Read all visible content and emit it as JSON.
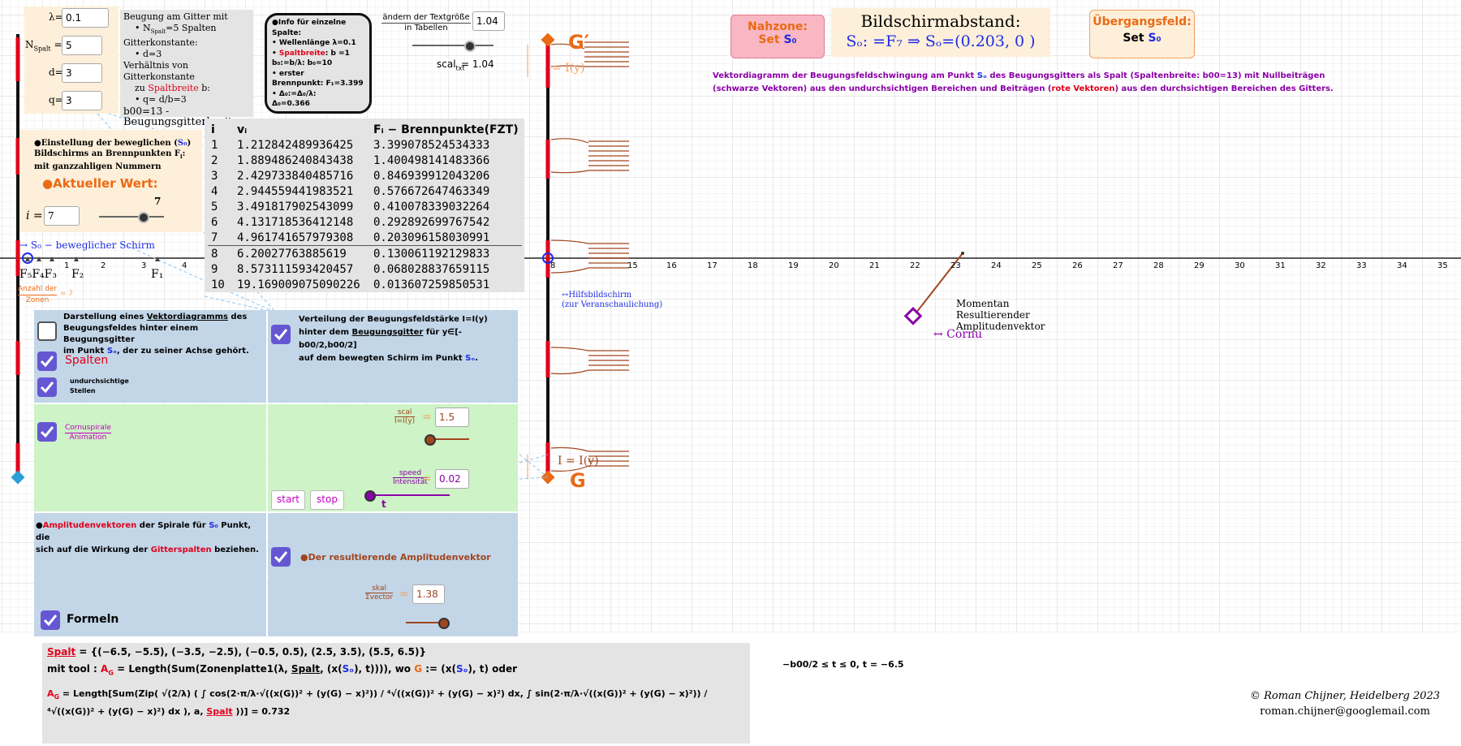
{
  "params": {
    "lambda_label": "λ=",
    "lambda_value": "0.1",
    "n_label": "N",
    "n_sub": "Spalt",
    "n_eq": " =",
    "n_value": "5",
    "d_label": "d=",
    "d_value": "3",
    "q_label": "q=",
    "q_value": "3"
  },
  "gitter_info": {
    "line1": "Beugung am Gitter mit",
    "line2": "• N",
    "line2_sub": "Spalt",
    "line2_rest": "=5 Spalten",
    "line3": "Gitterkonstante:",
    "line4": "• d=3",
    "line5": "Verhältnis von Gitterkonstante",
    "line6_a": "zu ",
    "line6_b": "Spaltbreite",
    "line6_c": " b:",
    "line7": "• q= d/b=3",
    "line8": "b00=13   -",
    "line9": "Beugungsgitterbreite"
  },
  "spalt_info": {
    "title": "●Info für einzelne Spalte:",
    "l1": "• Wellenlänge λ=0.1",
    "l2_a": "• ",
    "l2_b": "Spaltbreite",
    "l2_c": ": b =1",
    "l3": "b₀:=b/λ:     b₀=10",
    "l4": "• erster",
    "l5": "Brennpunkt:  F₁=3.399",
    "l6": "• Δ₀:=Δ₀/λ:",
    "l7": "Δ₀=0.366"
  },
  "textsize": {
    "label_top": "ändern der Textgröße",
    "label_bottom": "in Tabellen",
    "value": "1.04",
    "scal_label": "scal",
    "scal_sub": "txt",
    "scal_value": "= 1.04"
  },
  "nahzone": {
    "title": "Nahzone:",
    "set": "Set ",
    "s0": "S₀"
  },
  "bildschirm": {
    "title": "Bildschirmabstand:",
    "formula": "Sₒ: =F₇  ⇒  Sₒ=(0.203, 0 )"
  },
  "uebergang": {
    "title": "Übergangsfeld:",
    "set": "Set ",
    "s0": "S₀"
  },
  "vektor_desc": {
    "p1": "Vektordiagramm der Beugungsfeldschwingung am Punkt ",
    "s0": "Sₒ",
    "p2": " des Beugungsgitters als Spalt (Spaltenbreite: b00=13) mit Nullbeiträgen",
    "p3": "(schwarze Vektoren) aus den undurchsichtigen Bereichen und Beiträgen (",
    "p4": "rote Vektoren",
    "p5": ") aus den durchsichtigen Bereichen des Gitters."
  },
  "einstellung": {
    "l1_a": "●Einstellung der beweglichen (",
    "l1_b": "S₀",
    "l1_c": ")",
    "l2": "Bildschirms an Brennpunkten F",
    "l2_sub": "i",
    "l2_rest": ":",
    "l3": "mit ganzzahligen Nummern",
    "aktuell": "●Aktueller  Wert:",
    "i_label": "i =",
    "i_value": "7",
    "slider_value": "7"
  },
  "table": {
    "headers": [
      "i",
      "vᵢ",
      "Fᵢ − Brennpunkte(FZT)"
    ],
    "rows": [
      [
        "1",
        "1.212842489936425",
        "3.399078524534333"
      ],
      [
        "2",
        "1.889486240843438",
        "1.400498141483366"
      ],
      [
        "3",
        "2.429733840485716",
        "0.846939912043206"
      ],
      [
        "4",
        "2.944559441983521",
        "0.576672647463349"
      ],
      [
        "5",
        "3.491817902543099",
        "0.410078339032264"
      ],
      [
        "6",
        "4.131718536412148",
        "0.292892699767542"
      ],
      [
        "7",
        "4.961741657979308",
        "0.203096158030991"
      ],
      [
        "8",
        "6.20027763885619",
        "0.130061192129833"
      ],
      [
        "9",
        "8.573111593420457",
        "0.068028837659115"
      ],
      [
        "10",
        "19.169009075090226",
        "0.013607259850531"
      ]
    ]
  },
  "axis": {
    "s0_label": "→ S₀ − beweglicher Schirm",
    "f_labels": [
      "F₅",
      "F₄",
      "F₃",
      "F₂",
      "F₁"
    ],
    "anzahl_label_1": "Anzahl der",
    "anzahl_label_2": "Zonen",
    "anzahl_value": "= 7",
    "ticks": [
      "1",
      "2",
      "3",
      "4",
      "8",
      "15",
      "16",
      "17",
      "18",
      "19",
      "20",
      "21",
      "22",
      "23",
      "24",
      "25",
      "26",
      "27",
      "28",
      "29",
      "30",
      "31",
      "32",
      "33",
      "34",
      "35"
    ],
    "g_prime": "G′",
    "i_top": "= I(y)",
    "i_bottom": "I = I(y)",
    "g_label": "G",
    "hilfs_1": "↔Hilfsbildschirm",
    "hilfs_2": "(zur Veranschaulichung)",
    "momentan_1": "Momentan",
    "momentan_2": "Resultierender",
    "momentan_3": "Amplitudenvektor",
    "cornu": "↔ Cornu"
  },
  "left_panel": {
    "desc_1": "Darstellung eines ",
    "desc_vd": "Vektordiagramms",
    "desc_2": " des",
    "desc_3": "Beugungsfeldes hinter einem Beugungsgitter",
    "desc_4a": "im Punkt ",
    "desc_4b": "Sₒ",
    "desc_4c": ", der zu seiner Achse gehört.",
    "spalten": "Spalten",
    "undurch_1": "undurchsichtige",
    "undurch_2": "Stellen",
    "cornu_1": "Cornuspirale",
    "cornu_2": "Animation",
    "ampl_a": "●",
    "ampl_b": "Amplitudenvektoren",
    "ampl_c": " der Spirale für ",
    "ampl_d": "S₀",
    "ampl_e": " Punkt, die",
    "ampl_f": "sich auf die Wirkung der ",
    "ampl_g": "Gitterspalten",
    "ampl_h": " beziehen.",
    "formeln": "Formeln"
  },
  "right_panel": {
    "vert_1": "Verteilung der Beugungsfeldstärke I=I(y)",
    "vert_2a": "hinter dem ",
    "vert_2b": "Beugungsgitter",
    "vert_2c": " für y∈[-b00/2,b00/2]",
    "vert_3a": "auf dem bewegten Schirm im Punkt ",
    "vert_3b": "Sₒ",
    "vert_3c": ".",
    "scal_top": "scal",
    "scal_bottom": "I=I(y)",
    "scal_value": "1.5",
    "speed_top": "speed",
    "speed_bottom": "Intensität",
    "speed_value": "0.02",
    "start": "start",
    "stop": "stop",
    "t_label": "t",
    "result": "●Der resultierende Amplitudenvektor",
    "skal_top": "skal",
    "skal_bottom": "Σvector",
    "skal_value": "1.38"
  },
  "formula": {
    "l1_a": "Spalt",
    "l1_b": " = {(−6.5, −5.5), (−3.5, −2.5), (−0.5, 0.5), (2.5, 3.5), (5.5, 6.5)}",
    "l2_a": "mit tool : ",
    "l2_b": "A",
    "l2_c": " = Length(Sum(Zonenplatte1(λ, ",
    "l2_d": "Spalt",
    "l2_e": ", (x(",
    "l2_f": "Sₒ",
    "l2_g": "), t)))),  wo ",
    "l2_h": "G",
    "l2_i": " := (x(",
    "l2_j": "Sₒ",
    "l2_k": "), t) oder",
    "l3_a": "A",
    "l3_b": " = Length[Sum(Zip( √(2/λ) ( ∫ cos(2·π/λ·√((x(G))² + (y(G) − x)²)) / ⁴√((x(G))² + (y(G) − x)²) dx,  ∫ sin(2·π/λ·√((x(G))² + (y(G) − x)²)) / ⁴√((x(G))² + (y(G) − x)²) dx ), a, ",
    "l3_c": "Spalt",
    "l3_d": " ))] = 0.732",
    "range": "−b00/2 ≤ t ≤ 0,  t = −6.5"
  },
  "copyright": {
    "line1": "©   Roman Chijner,  Heidelberg  2023",
    "line2": "roman.chijner@googlemail.com"
  },
  "colors": {
    "red": "#e0001a",
    "blue": "#1e2ce6",
    "orange": "#ea6a14",
    "purple": "#8b00a8",
    "brown": "#a0461e",
    "checkbox": "#6557d2"
  }
}
